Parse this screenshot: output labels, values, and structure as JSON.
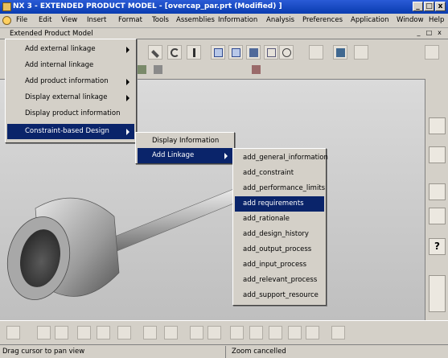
{
  "window": {
    "title": "NX 3 - EXTENDED PRODUCT MODEL - [overcap_par.prt (Modified) ]",
    "min_label": "_",
    "max_label": "□",
    "close_label": "x"
  },
  "menubar": {
    "items": [
      "File",
      "Edit",
      "View",
      "Insert",
      "Format",
      "Tools",
      "Assemblies",
      "Information",
      "Analysis",
      "Preferences",
      "Application",
      "Window",
      "Help"
    ]
  },
  "subbar": {
    "title": "Extended Product Model",
    "controls": [
      "_",
      "□",
      "x"
    ]
  },
  "menu1": {
    "items": [
      {
        "label": "Add external linkage",
        "submenu": true
      },
      {
        "label": "Add internal linkage",
        "submenu": false
      },
      {
        "label": "Add product information",
        "submenu": true
      },
      {
        "label": "Display external linkage",
        "submenu": true
      },
      {
        "label": "Display product information",
        "submenu": false
      },
      {
        "label": "Constraint-based Design",
        "submenu": true,
        "selected": true
      }
    ]
  },
  "menu2": {
    "items": [
      {
        "label": "Display Information",
        "submenu": false
      },
      {
        "label": "Add Linkage",
        "submenu": true,
        "selected": true
      }
    ]
  },
  "menu3": {
    "items": [
      {
        "label": "add_general_information"
      },
      {
        "label": "add_constraint"
      },
      {
        "label": "add_performance_limits"
      },
      {
        "label": "add requirements",
        "selected": true
      },
      {
        "label": "add_rationale"
      },
      {
        "label": "add_design_history"
      },
      {
        "label": "add_output_process"
      },
      {
        "label": "add_input_process"
      },
      {
        "label": "add_relevant_process"
      },
      {
        "label": "add_support_resource"
      }
    ]
  },
  "status": {
    "left": "Drag cursor to pan view",
    "center": "Zoom cancelled"
  },
  "colors": {
    "title_bg": "#0a3cb0",
    "menu_highlight": "#0a246a",
    "menu_bg": "#d4d0c8",
    "model_color": "#c8c8c8"
  }
}
